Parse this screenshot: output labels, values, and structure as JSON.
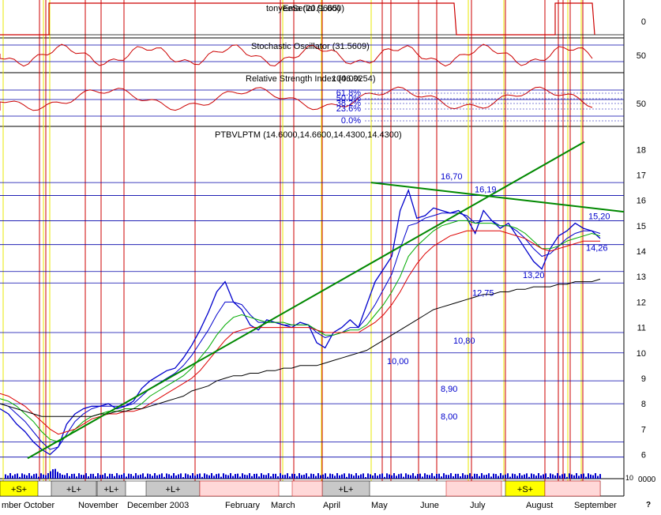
{
  "chart_data": {
    "type": "line",
    "panels": [
      {
        "name": "tonyeeSerial",
        "title": "tonyeeSerial (1.000)",
        "overlay_text": "Ema (20.9665)",
        "yticks": [
          "0"
        ]
      },
      {
        "name": "stochastic",
        "title": "Stochastic Oscillator (31.5609)",
        "yticks": [
          "50"
        ]
      },
      {
        "name": "rsi",
        "title": "Relative Strength Index (46.0254)",
        "overlay_text": "100.0%",
        "fib_labels": [
          "61.8%",
          "50.0%",
          "38.2%",
          "23.6%",
          "0.0%"
        ],
        "yticks": [
          "50"
        ]
      },
      {
        "name": "price",
        "title": "PTBVLPTM (14.6000,14.6600,14.4300,14.4300)",
        "yticks": [
          18,
          17,
          16,
          15,
          14,
          13,
          12,
          11,
          10,
          9,
          8,
          7,
          6
        ],
        "ylim": [
          5.3,
          18.6
        ],
        "support_resistance": [
          {
            "label": "16,70",
            "value": 16.7
          },
          {
            "label": "16,19",
            "value": 16.19
          },
          {
            "label": "15,20",
            "value": 15.2
          },
          {
            "label": "14,26",
            "value": 14.26
          },
          {
            "label": "13,20",
            "value": 13.2
          },
          {
            "label": "12,75",
            "value": 12.75
          },
          {
            "label": "10,80",
            "value": 10.8
          },
          {
            "label": "10,00",
            "value": 10.0
          },
          {
            "label": "8,90",
            "value": 8.9
          },
          {
            "label": "8,00",
            "value": 8.0
          }
        ],
        "series": [
          {
            "key": "close",
            "color": "#0000cc",
            "values": [
              7.8,
              7.6,
              7.2,
              6.9,
              6.5,
              6.2,
              6.0,
              6.3,
              7.2,
              7.6,
              7.8,
              7.9,
              7.9,
              8.0,
              7.8,
              7.9,
              8.1,
              8.6,
              8.9,
              9.1,
              9.3,
              9.4,
              9.8,
              10.3,
              10.9,
              11.6,
              12.4,
              12.8,
              12.0,
              11.7,
              11.1,
              10.9,
              11.3,
              11.2,
              11.1,
              11.0,
              11.2,
              11.1,
              10.4,
              10.2,
              10.8,
              11.0,
              11.3,
              11.0,
              11.9,
              12.8,
              13.3,
              13.8,
              15.6,
              16.4,
              15.3,
              15.4,
              15.7,
              15.6,
              15.5,
              15.6,
              15.3,
              14.7,
              15.6,
              15.2,
              14.9,
              15.1,
              14.6,
              14.1,
              13.6,
              13.3,
              14.1,
              14.6,
              14.8,
              15.1,
              14.9,
              14.8,
              14.5
            ]
          },
          {
            "key": "ema_fast",
            "color": "#0000cc",
            "values": [
              8.0,
              7.9,
              7.6,
              7.3,
              6.9,
              6.5,
              6.2,
              6.3,
              6.8,
              7.3,
              7.6,
              7.8,
              7.9,
              7.9,
              7.9,
              7.9,
              8.0,
              8.3,
              8.6,
              8.8,
              9.0,
              9.2,
              9.5,
              9.9,
              10.4,
              10.9,
              11.5,
              12.0,
              12.0,
              11.9,
              11.5,
              11.2,
              11.2,
              11.2,
              11.1,
              11.1,
              11.1,
              11.1,
              10.8,
              10.6,
              10.7,
              10.8,
              11.0,
              11.0,
              11.4,
              11.9,
              12.5,
              13.1,
              14.1,
              15.0,
              15.1,
              15.3,
              15.4,
              15.5,
              15.5,
              15.5,
              15.4,
              15.1,
              15.2,
              15.2,
              15.0,
              15.0,
              14.8,
              14.5,
              14.1,
              13.8,
              13.9,
              14.2,
              14.5,
              14.7,
              14.8,
              14.8,
              14.7
            ]
          },
          {
            "key": "ema_mid",
            "color": "#00aa00",
            "values": [
              8.2,
              8.1,
              7.9,
              7.6,
              7.3,
              6.9,
              6.6,
              6.5,
              6.7,
              7.0,
              7.3,
              7.5,
              7.6,
              7.7,
              7.7,
              7.8,
              7.8,
              8.0,
              8.3,
              8.5,
              8.7,
              8.9,
              9.1,
              9.4,
              9.8,
              10.2,
              10.7,
              11.1,
              11.4,
              11.5,
              11.4,
              11.3,
              11.2,
              11.2,
              11.2,
              11.1,
              11.1,
              11.1,
              10.9,
              10.7,
              10.7,
              10.8,
              10.9,
              10.9,
              11.1,
              11.5,
              11.9,
              12.4,
              13.0,
              13.8,
              14.2,
              14.5,
              14.8,
              15.0,
              15.1,
              15.2,
              15.2,
              15.1,
              15.1,
              15.1,
              15.0,
              15.0,
              14.9,
              14.7,
              14.4,
              14.1,
              14.1,
              14.2,
              14.4,
              14.5,
              14.6,
              14.7,
              14.6
            ]
          },
          {
            "key": "ema_slow",
            "color": "#dd0000",
            "values": [
              8.4,
              8.3,
              8.1,
              7.9,
              7.6,
              7.3,
              7.0,
              6.8,
              6.9,
              7.0,
              7.2,
              7.4,
              7.5,
              7.6,
              7.6,
              7.7,
              7.7,
              7.8,
              8.0,
              8.2,
              8.4,
              8.6,
              8.8,
              9.0,
              9.3,
              9.7,
              10.1,
              10.5,
              10.8,
              10.9,
              11.0,
              11.0,
              11.0,
              11.0,
              11.0,
              11.0,
              11.0,
              11.0,
              10.9,
              10.8,
              10.8,
              10.8,
              10.8,
              10.8,
              11.0,
              11.2,
              11.5,
              11.9,
              12.4,
              13.0,
              13.5,
              13.9,
              14.2,
              14.4,
              14.6,
              14.7,
              14.8,
              14.8,
              14.8,
              14.8,
              14.8,
              14.7,
              14.6,
              14.5,
              14.3,
              14.1,
              14.0,
              14.1,
              14.2,
              14.3,
              14.4,
              14.4,
              14.4
            ]
          },
          {
            "key": "sma_long",
            "color": "#000000",
            "values": [
              8.0,
              7.9,
              7.8,
              7.7,
              7.6,
              7.5,
              7.5,
              7.5,
              7.5,
              7.5,
              7.5,
              7.5,
              7.6,
              7.6,
              7.7,
              7.7,
              7.8,
              7.8,
              7.9,
              8.0,
              8.1,
              8.2,
              8.3,
              8.5,
              8.6,
              8.7,
              8.9,
              9.0,
              9.1,
              9.1,
              9.2,
              9.2,
              9.3,
              9.3,
              9.4,
              9.4,
              9.5,
              9.5,
              9.5,
              9.6,
              9.7,
              9.8,
              9.9,
              10.0,
              10.1,
              10.3,
              10.5,
              10.7,
              10.9,
              11.1,
              11.3,
              11.5,
              11.7,
              11.8,
              11.9,
              12.0,
              12.1,
              12.2,
              12.3,
              12.3,
              12.4,
              12.4,
              12.5,
              12.5,
              12.6,
              12.6,
              12.6,
              12.7,
              12.7,
              12.8,
              12.8,
              12.8,
              12.9
            ]
          }
        ]
      }
    ],
    "x_axis_labels": [
      "mber",
      "October",
      "November",
      "December 2003",
      "February",
      "March",
      "April",
      "May",
      "June",
      "July",
      "August",
      "September"
    ],
    "markers": [
      "+S+",
      "+L+",
      "+L+",
      "+L+",
      "+L+",
      "+S+"
    ],
    "volume_label": "10",
    "volume_value": "0000",
    "corner_label": "?"
  }
}
